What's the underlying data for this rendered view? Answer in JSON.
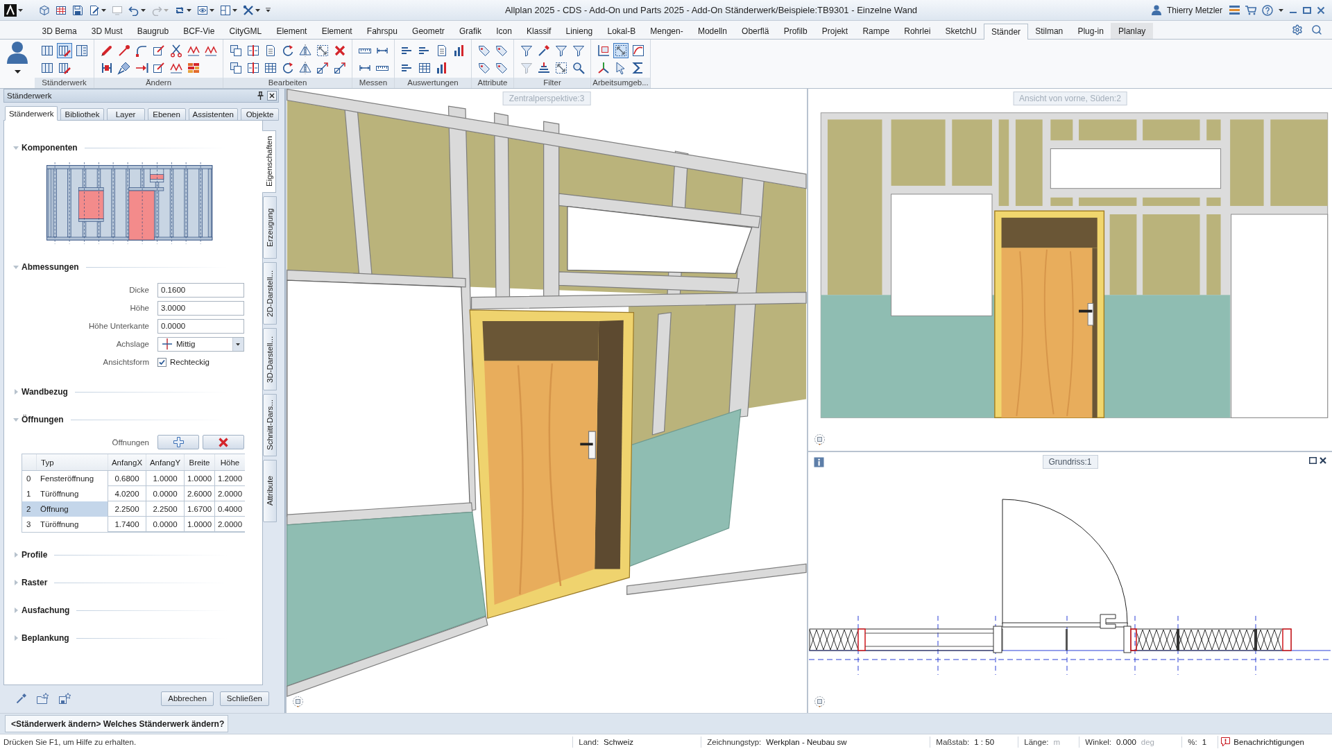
{
  "window": {
    "title": "Allplan 2025 - CDS - Add-On und Parts 2025 - Add-On Ständerwerk/Beispiele:TB9301 - Einzelne Wand",
    "user": "Thierry Metzler"
  },
  "quick_access": [
    {
      "disabled": false,
      "dropdown": false
    },
    {
      "disabled": false,
      "dropdown": false
    },
    {
      "disabled": false,
      "dropdown": false
    },
    {
      "disabled": false,
      "dropdown": true
    },
    {
      "disabled": true,
      "dropdown": false
    },
    {
      "disabled": false,
      "dropdown": true
    },
    {
      "disabled": true,
      "dropdown": true
    },
    {
      "disabled": false,
      "dropdown": true
    },
    {
      "disabled": false,
      "dropdown": true
    },
    {
      "disabled": false,
      "dropdown": true
    },
    {
      "disabled": false,
      "dropdown": true
    }
  ],
  "menu_tabs": [
    {
      "label": "3D Bema",
      "selected": false,
      "hovered": false
    },
    {
      "label": "3D Must",
      "selected": false,
      "hovered": false
    },
    {
      "label": "Baugrub",
      "selected": false,
      "hovered": false
    },
    {
      "label": "BCF-Vie",
      "selected": false,
      "hovered": false
    },
    {
      "label": "CityGML",
      "selected": false,
      "hovered": false
    },
    {
      "label": "Element",
      "selected": false,
      "hovered": false
    },
    {
      "label": "Element",
      "selected": false,
      "hovered": false
    },
    {
      "label": "Fahrspu",
      "selected": false,
      "hovered": false
    },
    {
      "label": "Geometr",
      "selected": false,
      "hovered": false
    },
    {
      "label": "Grafik",
      "selected": false,
      "hovered": false
    },
    {
      "label": "Icon",
      "selected": false,
      "hovered": false
    },
    {
      "label": "Klassif",
      "selected": false,
      "hovered": false
    },
    {
      "label": "Linieng",
      "selected": false,
      "hovered": false
    },
    {
      "label": "Lokal-B",
      "selected": false,
      "hovered": false
    },
    {
      "label": "Mengen-",
      "selected": false,
      "hovered": false
    },
    {
      "label": "Modelln",
      "selected": false,
      "hovered": false
    },
    {
      "label": "Oberflä",
      "selected": false,
      "hovered": false
    },
    {
      "label": "Profilb",
      "selected": false,
      "hovered": false
    },
    {
      "label": "Projekt",
      "selected": false,
      "hovered": false
    },
    {
      "label": "Rampe",
      "selected": false,
      "hovered": false
    },
    {
      "label": "Rohrlei",
      "selected": false,
      "hovered": false
    },
    {
      "label": "SketchU",
      "selected": false,
      "hovered": false
    },
    {
      "label": "Ständer",
      "selected": true,
      "hovered": false
    },
    {
      "label": "Stilman",
      "selected": false,
      "hovered": false
    },
    {
      "label": "Plug-in",
      "selected": false,
      "hovered": false
    },
    {
      "label": "Planlay",
      "selected": false,
      "hovered": true
    }
  ],
  "ribbon": {
    "groups": [
      {
        "label": "Ständerwerk",
        "tools": [
          {
            "selected": false,
            "disabled": false
          },
          {
            "selected": true,
            "disabled": false
          },
          {
            "selected": false,
            "disabled": false
          },
          {
            "selected": false,
            "disabled": false
          },
          {
            "selected": false,
            "disabled": false
          }
        ]
      },
      {
        "label": "Ändern",
        "tools": [
          {
            "selected": false,
            "disabled": false
          },
          {
            "selected": false,
            "disabled": false
          },
          {
            "selected": false,
            "disabled": false
          },
          {
            "selected": false,
            "disabled": false
          },
          {
            "selected": false,
            "disabled": false
          },
          {
            "selected": false,
            "disabled": false
          },
          {
            "selected": false,
            "disabled": false
          },
          {
            "selected": false,
            "disabled": false
          },
          {
            "selected": false,
            "disabled": false
          },
          {
            "selected": false,
            "disabled": false
          },
          {
            "selected": false,
            "disabled": false
          },
          {
            "selected": false,
            "disabled": false
          },
          {
            "selected": false,
            "disabled": false
          }
        ]
      },
      {
        "label": "Bearbeiten",
        "tools": [
          {
            "selected": false,
            "disabled": false
          },
          {
            "selected": false,
            "disabled": false
          },
          {
            "selected": false,
            "disabled": false
          },
          {
            "selected": false,
            "disabled": false
          },
          {
            "selected": false,
            "disabled": false
          },
          {
            "selected": false,
            "disabled": false
          },
          {
            "selected": false,
            "disabled": false
          },
          {
            "selected": false,
            "disabled": false
          },
          {
            "selected": false,
            "disabled": false
          },
          {
            "selected": false,
            "disabled": false
          },
          {
            "selected": false,
            "disabled": false
          },
          {
            "selected": false,
            "disabled": false
          },
          {
            "selected": false,
            "disabled": false
          },
          {
            "selected": false,
            "disabled": false
          }
        ]
      },
      {
        "label": "Messen",
        "tools": [
          {
            "selected": false,
            "disabled": false
          },
          {
            "selected": false,
            "disabled": false
          },
          {
            "selected": false,
            "disabled": false
          },
          {
            "selected": false,
            "disabled": false
          }
        ]
      },
      {
        "label": "Auswertungen",
        "tools": [
          {
            "selected": false,
            "disabled": false
          },
          {
            "selected": false,
            "disabled": false
          },
          {
            "selected": false,
            "disabled": false
          },
          {
            "selected": false,
            "disabled": false
          },
          {
            "selected": false,
            "disabled": false
          },
          {
            "selected": false,
            "disabled": false
          },
          {
            "selected": false,
            "disabled": false
          }
        ]
      },
      {
        "label": "Attribute",
        "tools": [
          {
            "selected": false,
            "disabled": false
          },
          {
            "selected": false,
            "disabled": false
          },
          {
            "selected": false,
            "disabled": false
          },
          {
            "selected": false,
            "disabled": false
          }
        ]
      },
      {
        "label": "Filter",
        "tools": [
          {
            "selected": false,
            "disabled": false
          },
          {
            "selected": false,
            "disabled": false
          },
          {
            "selected": false,
            "disabled": false
          },
          {
            "selected": false,
            "disabled": false
          },
          {
            "selected": false,
            "disabled": true
          },
          {
            "selected": false,
            "disabled": false
          },
          {
            "selected": false,
            "disabled": false
          },
          {
            "selected": false,
            "disabled": false
          }
        ]
      },
      {
        "label": "Arbeitsumgeb...",
        "tools": [
          {
            "selected": false,
            "disabled": false
          },
          {
            "selected": true,
            "disabled": false
          },
          {
            "selected": false,
            "disabled": false
          },
          {
            "selected": false,
            "disabled": false
          },
          {
            "selected": false,
            "disabled": false
          },
          {
            "selected": false,
            "disabled": false
          }
        ]
      }
    ]
  },
  "panel": {
    "title": "Ständerwerk",
    "tabs": [
      {
        "label": "Ständerwerk",
        "selected": true
      },
      {
        "label": "Bibliothek",
        "selected": false
      },
      {
        "label": "Layer",
        "selected": false
      },
      {
        "label": "Ebenen",
        "selected": false
      },
      {
        "label": "Assistenten",
        "selected": false
      },
      {
        "label": "Objekte",
        "selected": false
      }
    ],
    "side_tabs": [
      {
        "label": "Eigenschaften",
        "selected": true
      },
      {
        "label": "Erzeugung",
        "selected": false
      },
      {
        "label": "2D-Darstell...",
        "selected": false
      },
      {
        "label": "3D-Darstell...",
        "selected": false
      },
      {
        "label": "Schnitt-Dars...",
        "selected": false
      },
      {
        "label": "Attribute",
        "selected": false
      }
    ],
    "sections": [
      {
        "kind": "diagram",
        "title": "Komponenten",
        "expanded": true
      },
      {
        "kind": "fields",
        "title": "Abmessungen",
        "expanded": true,
        "fields": [
          {
            "kind": "text",
            "label": "Dicke",
            "value": "0.1600"
          },
          {
            "kind": "text",
            "label": "Höhe",
            "value": "3.0000"
          },
          {
            "kind": "text",
            "label": "Höhe Unterkante",
            "value": "0.0000"
          },
          {
            "kind": "select",
            "label": "Achslage",
            "value": "Mittig"
          },
          {
            "kind": "checkbox",
            "label": "Ansichtsform",
            "value": "Rechteckig",
            "checked": true
          }
        ]
      },
      {
        "title": "Wandbezug",
        "expanded": false
      },
      {
        "kind": "table",
        "title": "Öffnungen",
        "expanded": true,
        "toolbar_label": "Öffnungen",
        "columns": [
          "Typ",
          "AnfangX",
          "AnfangY",
          "Breite",
          "Höhe"
        ],
        "rows": [
          {
            "number": "0",
            "cells": [
              "Fensteröffnung",
              "0.6800",
              "1.0000",
              "1.0000",
              "1.2000"
            ],
            "selected": false
          },
          {
            "number": "1",
            "cells": [
              "Türöffnung",
              "4.0200",
              "0.0000",
              "2.6000",
              "2.0000"
            ],
            "selected": false
          },
          {
            "number": "2",
            "cells": [
              "Öffnung",
              "2.2500",
              "2.2500",
              "1.6700",
              "0.4000"
            ],
            "selected": true
          },
          {
            "number": "3",
            "cells": [
              "Türöffnung",
              "1.7400",
              "0.0000",
              "1.0000",
              "2.0000"
            ],
            "selected": false
          }
        ]
      },
      {
        "title": "Profile",
        "expanded": false
      },
      {
        "title": "Raster",
        "expanded": false
      },
      {
        "title": "Ausfachung",
        "expanded": false
      },
      {
        "title": "Beplankung",
        "expanded": false
      }
    ],
    "buttons": [
      "Abbrechen",
      "Schließen"
    ]
  },
  "viewports": [
    {
      "kind": "perspective",
      "label": "Zentralperspektive:3",
      "active": false
    },
    {
      "kind": "elevation",
      "label": "Ansicht von vorne, Süden:2",
      "active": false
    },
    {
      "kind": "plan",
      "label": "Grundriss:1",
      "active": true
    }
  ],
  "command_line": "<Ständerwerk ändern> Welches Ständerwerk ändern?",
  "status_bar": {
    "hint": "Drücken Sie F1, um Hilfe zu erhalten.",
    "items": [
      {
        "label": "Land:",
        "value": "Schweiz"
      },
      {
        "label": "Zeichnungstyp:",
        "value": "Werkplan - Neubau sw"
      },
      {
        "label": "Maßstab:",
        "value": "1 : 50"
      },
      {
        "label": "Länge:",
        "unit": "m"
      },
      {
        "label": "Winkel:",
        "value": "0.000",
        "unit": "deg"
      },
      {
        "label": "%:",
        "value": "1"
      }
    ],
    "notifications": "Benachrichtigungen"
  }
}
